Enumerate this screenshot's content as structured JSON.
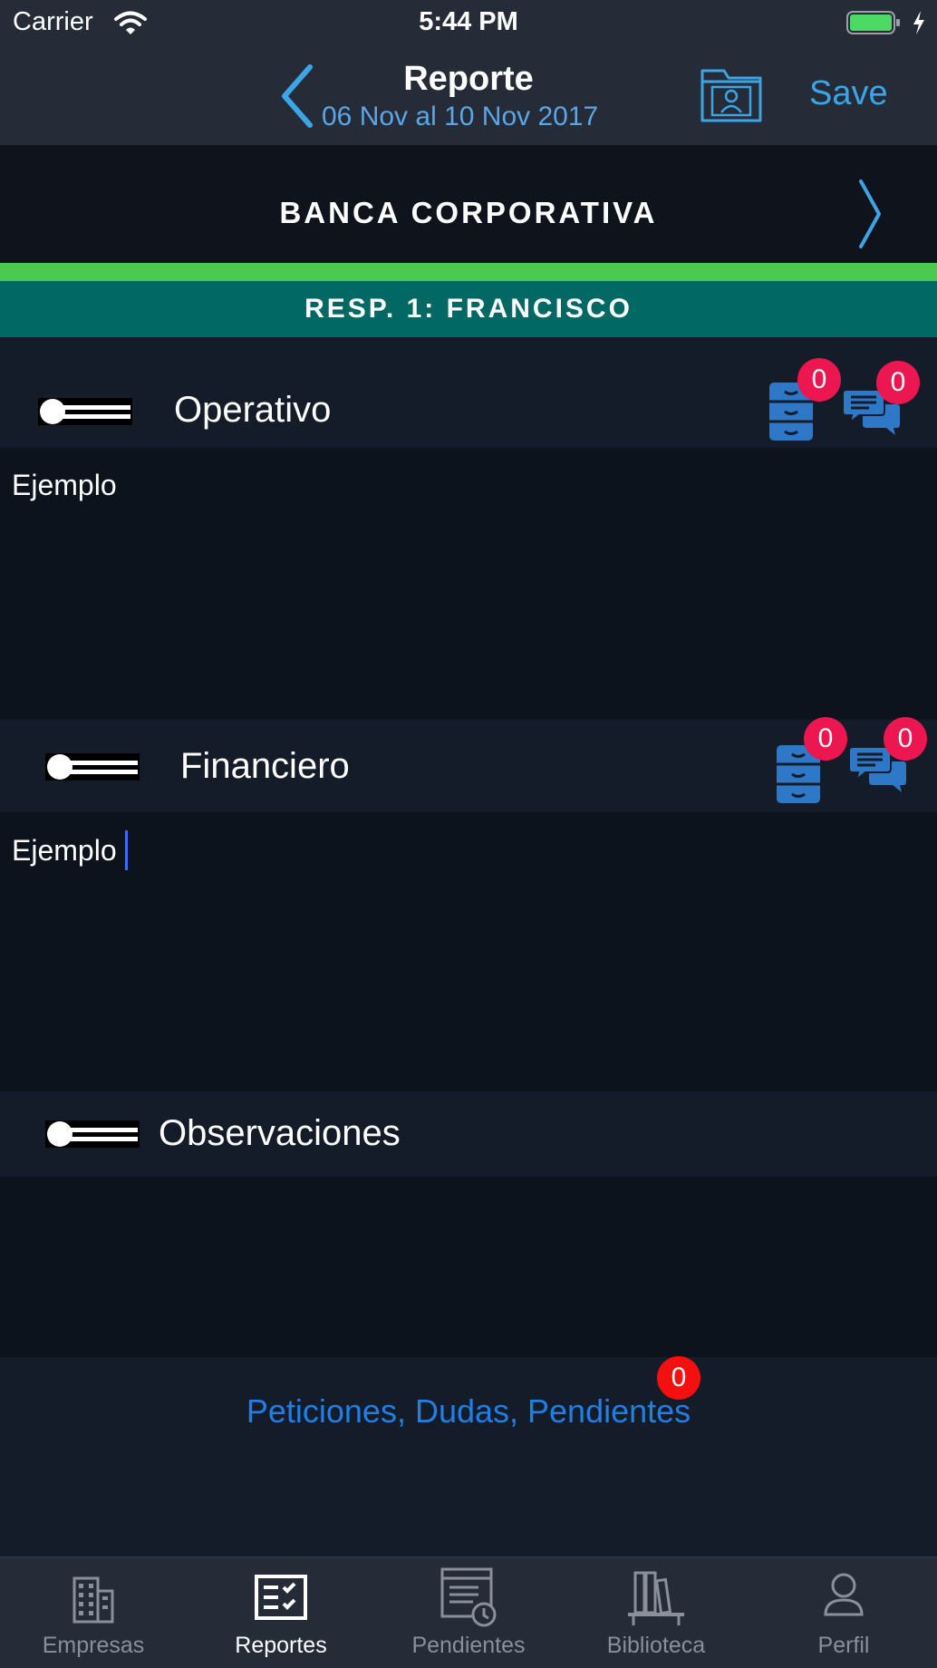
{
  "status_bar": {
    "carrier": "Carrier",
    "time": "5:44 PM"
  },
  "nav": {
    "title": "Reporte",
    "subtitle": "06 Nov al 10 Nov 2017",
    "save_label": "Save"
  },
  "company": {
    "name": "BANCA CORPORATIVA"
  },
  "responsible": {
    "label": "RESP. 1: FRANCISCO"
  },
  "sections": [
    {
      "title": "Operativo",
      "text": "Ejemplo",
      "files_count": "0",
      "comments_count": "0"
    },
    {
      "title": "Financiero",
      "text": "Ejemplo",
      "files_count": "0",
      "comments_count": "0"
    },
    {
      "title": "Observaciones",
      "text": ""
    }
  ],
  "requests": {
    "label": "Peticiones, Dudas, Pendientes",
    "count": "0"
  },
  "tabbar": {
    "items": [
      {
        "label": "Empresas",
        "icon": "building-icon",
        "active": false
      },
      {
        "label": "Reportes",
        "icon": "checklist-icon",
        "active": true
      },
      {
        "label": "Pendientes",
        "icon": "pending-clock-icon",
        "active": false
      },
      {
        "label": "Biblioteca",
        "icon": "library-books-icon",
        "active": false
      },
      {
        "label": "Perfil",
        "icon": "person-icon",
        "active": false
      }
    ]
  },
  "colors": {
    "accent_blue": "#3ba5e8",
    "green_strip": "#4cc94e",
    "resp_bar": "#016863",
    "badge_red": "#ec1750",
    "link_blue": "#1f7fe6"
  }
}
